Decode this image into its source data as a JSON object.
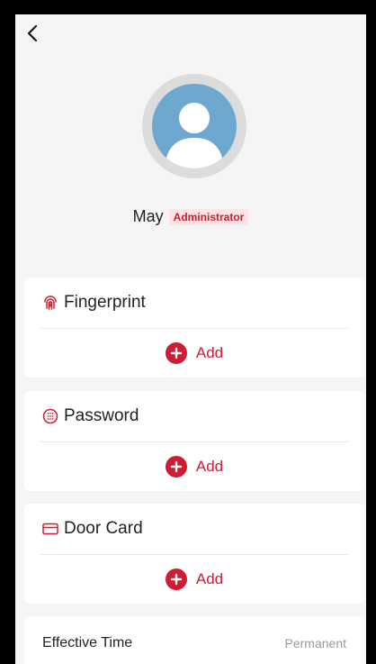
{
  "profile": {
    "name": "May",
    "role": "Administrator"
  },
  "credentials": [
    {
      "label": "Fingerprint",
      "icon": "fingerprint-icon",
      "add_label": "Add"
    },
    {
      "label": "Password",
      "icon": "keypad-icon",
      "add_label": "Add"
    },
    {
      "label": "Door Card",
      "icon": "card-icon",
      "add_label": "Add"
    }
  ],
  "effective": {
    "label": "Effective Time",
    "value": "Permanent"
  },
  "colors": {
    "accent": "#cf1c33",
    "badge_bg": "#fce5e5",
    "avatar_bg": "#6fa8cf",
    "page_bg": "#f5f5f5"
  }
}
